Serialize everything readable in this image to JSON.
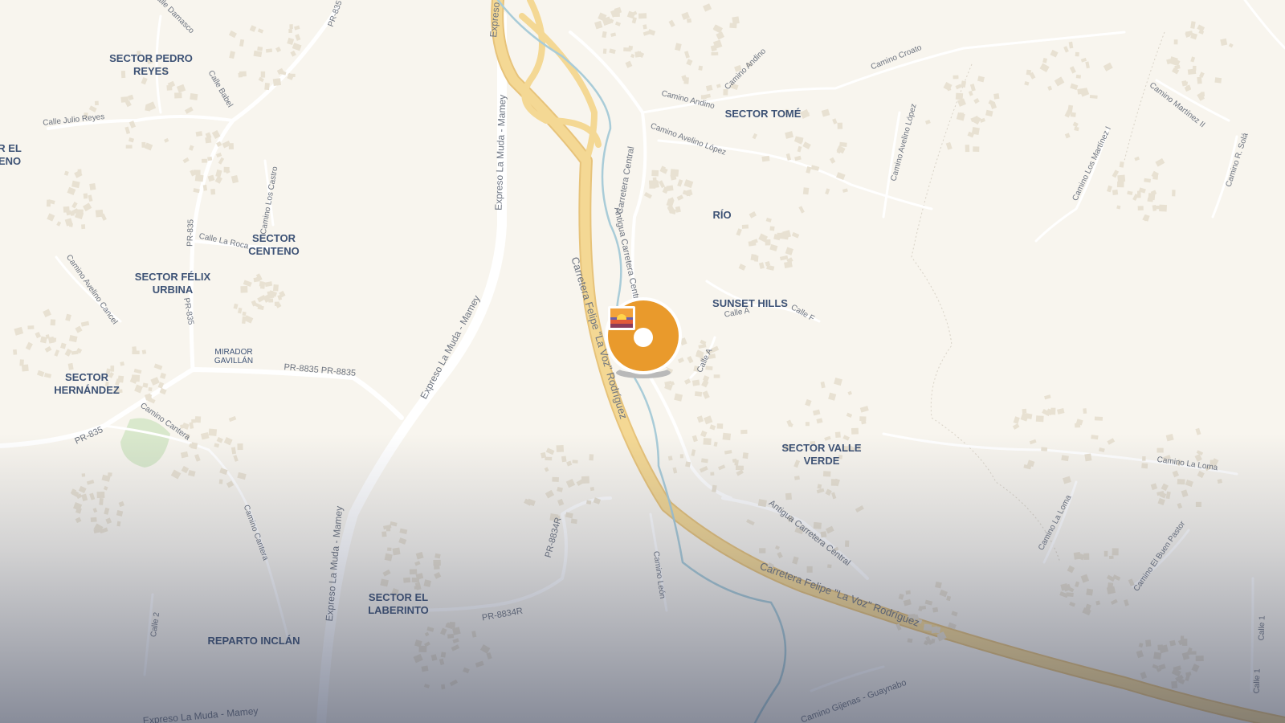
{
  "map": {
    "colors": {
      "land": "#f8f5ee",
      "minor_road": "#ffffff",
      "highway": "#f2d389",
      "highway_edge": "#e7c37a",
      "river": "#a9ccd8",
      "park": "#d9e8cc",
      "area_label": "#3d5275",
      "road_label": "#6d7480",
      "marker": "#e99a2c"
    },
    "area_labels": [
      {
        "text": "SECTOR PEDRO REYES",
        "lines": [
          "SECTOR PEDRO",
          "REYES"
        ]
      },
      {
        "text": "SECTOR TOMÉ",
        "lines": [
          "SECTOR TOMÉ"
        ]
      },
      {
        "text": "R EL ENO",
        "lines": [
          "R EL",
          "ENO"
        ]
      },
      {
        "text": "SECTOR CENTENO",
        "lines": [
          "SECTOR",
          "CENTENO"
        ]
      },
      {
        "text": "RÍO",
        "lines": [
          "RÍO"
        ]
      },
      {
        "text": "SECTOR FÉLIX URBINA",
        "lines": [
          "SECTOR FÉLIX",
          "URBINA"
        ]
      },
      {
        "text": "SUNSET HILLS",
        "lines": [
          "SUNSET HILLS"
        ]
      },
      {
        "text": "MIRADOR GAVILLÁN",
        "lines": [
          "MIRADOR",
          "GAVILLÁN"
        ]
      },
      {
        "text": "SECTOR HERNÁNDEZ",
        "lines": [
          "SECTOR",
          "HERNÁNDEZ"
        ]
      },
      {
        "text": "SECTOR VALLE VERDE",
        "lines": [
          "SECTOR VALLE",
          "VERDE"
        ]
      },
      {
        "text": "SECTOR EL LABERINTO",
        "lines": [
          "SECTOR EL",
          "LABERINTO"
        ]
      },
      {
        "text": "REPARTO INCLÁN",
        "lines": [
          "REPARTO INCLÁN"
        ]
      }
    ],
    "road_labels": [
      {
        "text": "Calle Damasco"
      },
      {
        "text": "PR-835"
      },
      {
        "text": "Expreso"
      },
      {
        "text": "Expreso La Muda - Mamey"
      },
      {
        "text": "Calle Babel"
      },
      {
        "text": "Calle Julio Reyes"
      },
      {
        "text": "Camino Andino"
      },
      {
        "text": "Camino Andino"
      },
      {
        "text": "Camino Croato"
      },
      {
        "text": "Camino Martínez II"
      },
      {
        "text": "Camino Avelino López"
      },
      {
        "text": "Camino Avelino López"
      },
      {
        "text": "Camino Los Martínez I"
      },
      {
        "text": "Camino R. Solá"
      },
      {
        "text": "Carretera Central"
      },
      {
        "text": "Antigua Carretera Central"
      },
      {
        "text": "Camino Los Castro"
      },
      {
        "text": "PR-835"
      },
      {
        "text": "Calle La Roca"
      },
      {
        "text": "Camino Avelino Cancel"
      },
      {
        "text": "PR-835"
      },
      {
        "text": "Calle F"
      },
      {
        "text": "Calle A"
      },
      {
        "text": "Calle A"
      },
      {
        "text": "Carretera Felipe \"La Voz\" Rodríguez"
      },
      {
        "text": "PR-8835 PR-8835"
      },
      {
        "text": "Expreso La Muda - Mamey"
      },
      {
        "text": "Camino Cantera"
      },
      {
        "text": "PR-835"
      },
      {
        "text": "Camino La Loma"
      },
      {
        "text": "Antigua Carretera Central"
      },
      {
        "text": "Camino La Loma"
      },
      {
        "text": "Camino El Buen Pastor"
      },
      {
        "text": "PR-8834R"
      },
      {
        "text": "Camino Cantera"
      },
      {
        "text": "Camino León"
      },
      {
        "text": "Carretera Felipe \"La Voz\" Rodríguez"
      },
      {
        "text": "PR-8834R"
      },
      {
        "text": "Expreso La Muda - Mamey"
      },
      {
        "text": "Calle 2"
      },
      {
        "text": "Calle 1"
      },
      {
        "text": "Calle 1"
      },
      {
        "text": "Camino Gijenas - Guaynabo"
      },
      {
        "text": "Expreso La Muda - Mamey"
      }
    ],
    "marker": {
      "icon": "sunset-photo-icon"
    }
  }
}
